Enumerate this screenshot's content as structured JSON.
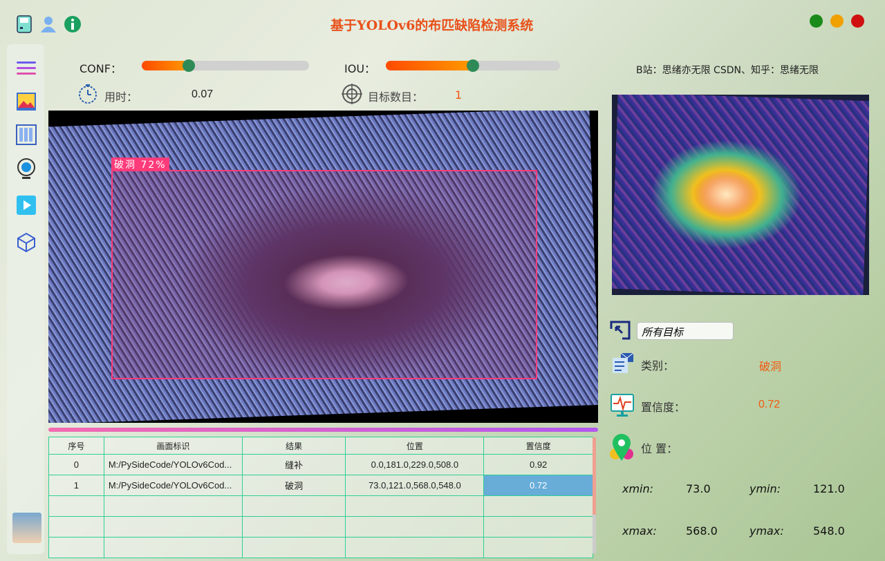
{
  "window": {
    "title": "基于YOLOv6的布匹缺陷检测系统",
    "top_icons": [
      "save-icon",
      "user-icon",
      "info-icon"
    ],
    "controls": {
      "minimize": "#1a8a1a",
      "maximize": "#f0a000",
      "close": "#d01010"
    }
  },
  "sidebar": {
    "items": [
      "menu-icon",
      "image-icon",
      "folder-icon",
      "camera-icon",
      "video-icon",
      "model-icon"
    ]
  },
  "controls": {
    "conf_label": "CONF：",
    "conf_value": 0.28,
    "iou_label": "IOU：",
    "iou_value": 0.5
  },
  "stats": {
    "time_label": "用时：",
    "time_value": "0.07",
    "count_label": "目标数目：",
    "count_value": "1"
  },
  "credit": "B站：思绪亦无限  CSDN、知乎：思绪无限",
  "detection": {
    "label": "破洞 72%"
  },
  "table": {
    "headers": [
      "序号",
      "画面标识",
      "结果",
      "位置",
      "置信度"
    ],
    "rows": [
      [
        "0",
        "M:/PySideCode/YOLOv6Cod...",
        "缝补",
        "0.0,181.0,229.0,508.0",
        "0.92"
      ],
      [
        "1",
        "M:/PySideCode/YOLOv6Cod...",
        "破洞",
        "73.0,121.0,568.0,548.0",
        "0.72"
      ]
    ]
  },
  "details": {
    "target_select": "所有目标",
    "class_label": "类别：",
    "class_value": "破洞",
    "conf_label": "置信度：",
    "conf_value": "0.72",
    "pos_label": "位 置：",
    "xmin_label": "xmin:",
    "xmin": "73.0",
    "ymin_label": "ymin:",
    "ymin": "121.0",
    "xmax_label": "xmax:",
    "xmax": "568.0",
    "ymax_label": "ymax:",
    "ymax": "548.0"
  }
}
